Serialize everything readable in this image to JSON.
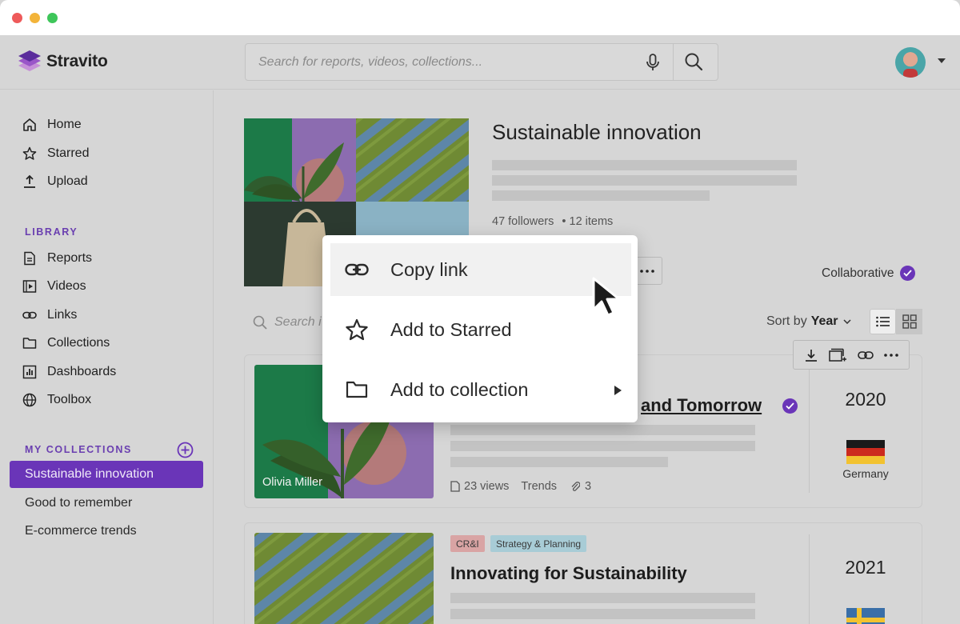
{
  "app": {
    "name": "Stravito"
  },
  "search": {
    "placeholder": "Search for reports, videos, collections..."
  },
  "sidebar": {
    "nav": [
      {
        "label": "Home",
        "icon": "home-icon"
      },
      {
        "label": "Starred",
        "icon": "star-icon"
      },
      {
        "label": "Upload",
        "icon": "upload-icon"
      }
    ],
    "library_label": "LIBRARY",
    "library": [
      {
        "label": "Reports",
        "icon": "report-icon"
      },
      {
        "label": "Videos",
        "icon": "video-icon"
      },
      {
        "label": "Links",
        "icon": "link-icon"
      },
      {
        "label": "Collections",
        "icon": "folder-icon"
      },
      {
        "label": "Dashboards",
        "icon": "dashboard-icon"
      },
      {
        "label": "Toolbox",
        "icon": "globe-icon"
      }
    ],
    "my_collections_label": "MY COLLECTIONS",
    "collections": [
      {
        "label": "Sustainable innovation",
        "active": true
      },
      {
        "label": "Good to remember",
        "active": false
      },
      {
        "label": "E-commerce trends",
        "active": false
      }
    ]
  },
  "collection": {
    "title": "Sustainable innovation",
    "followers": "47 followers",
    "items": "• 12 items",
    "collab_label": "Collaborative"
  },
  "filter": {
    "search_placeholder": "Search i",
    "sort_prefix": "Sort by",
    "sort_value": "Year"
  },
  "cards": [
    {
      "title": "and Tomorrow",
      "caption": "Olivia Miller",
      "views": "23 views",
      "topic": "Trends",
      "attachments": "3",
      "year": "2020",
      "country": "Germany"
    },
    {
      "tags": [
        "CR&I",
        "Strategy & Planning"
      ],
      "title": "Innovating for Sustainability",
      "year": "2021"
    }
  ],
  "context_menu": {
    "items": [
      {
        "label": "Copy link",
        "icon": "link-icon"
      },
      {
        "label": "Add to Starred",
        "icon": "star-icon"
      },
      {
        "label": "Add to collection",
        "icon": "folder-icon"
      }
    ]
  },
  "colors": {
    "accent": "#6a35b8",
    "tag_cri": "#e8b4b4",
    "tag_strategy": "#b4d8e0"
  }
}
